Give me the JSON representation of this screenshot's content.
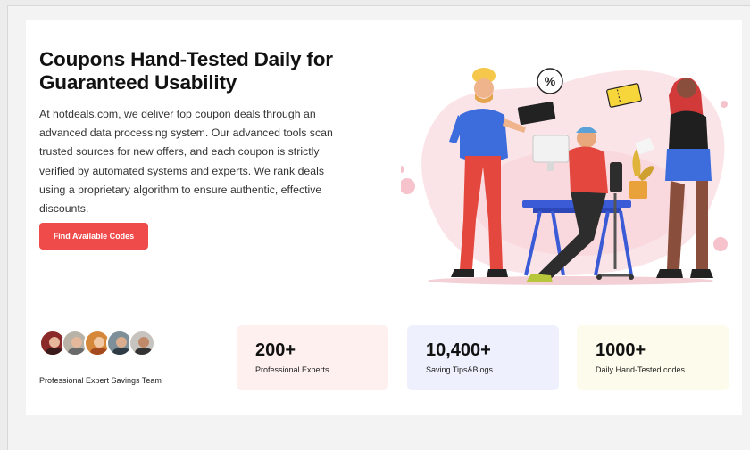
{
  "hero": {
    "title": "Coupons Hand-Tested Daily for Guaranteed Usability",
    "description": "At hotdeals.com, we deliver top coupon deals through an advanced data processing system. Our advanced tools scan trusted sources for new offers, and each coupon is strictly verified by automated systems and experts. We rank deals using a proprietary algorithm to ensure authentic, effective discounts.",
    "cta_label": "Find Available Codes"
  },
  "illustration": {
    "badge_symbol": "%"
  },
  "team": {
    "label": "Professional Expert Savings Team"
  },
  "stats": [
    {
      "value": "200+",
      "label": "Professional Experts",
      "bg": "#fdf0ef"
    },
    {
      "value": "10,400+",
      "label": "Saving Tips&Blogs",
      "bg": "#eef1fd"
    },
    {
      "value": "1000+",
      "label": "Daily Hand-Tested codes",
      "bg": "#fdfbec"
    }
  ],
  "colors": {
    "accent": "#ef4b4b"
  }
}
